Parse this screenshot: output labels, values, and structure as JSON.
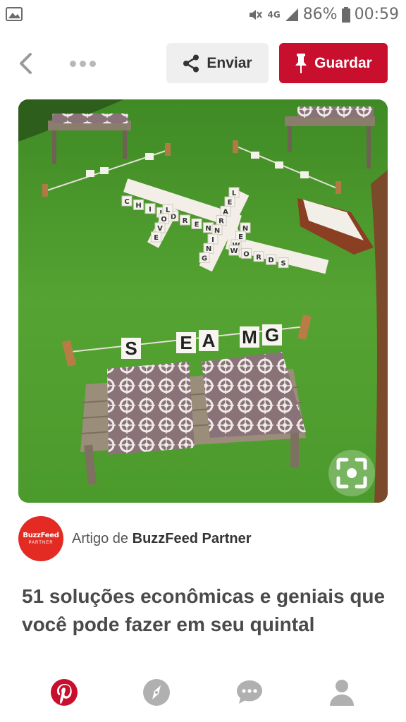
{
  "status_bar": {
    "battery": "86%",
    "time": "00:59",
    "network": "4G"
  },
  "toolbar": {
    "send_label": "Enviar",
    "save_label": "Guardar"
  },
  "image": {
    "scrabble_words": [
      "CHILDREN",
      "LEARNING",
      "LOVE",
      "NEW",
      "WORDS"
    ],
    "line_tiles": [
      "S",
      "E",
      "A",
      "M",
      "G"
    ]
  },
  "attribution": {
    "avatar_brand": "BuzzFeed",
    "avatar_sub": "PARTNER",
    "prefix": "Artigo de",
    "source": "BuzzFeed Partner"
  },
  "pin": {
    "title": "51 soluções econômicas e geniais que você pode fazer em seu quintal"
  },
  "colors": {
    "save": "#c8102e",
    "send_bg": "#efefef",
    "avatar": "#e32b24",
    "nav_active": "#c8102e",
    "nav_inactive": "#b0b0b0"
  },
  "bottom_nav": [
    "pinterest-home",
    "explore",
    "messages",
    "profile"
  ]
}
